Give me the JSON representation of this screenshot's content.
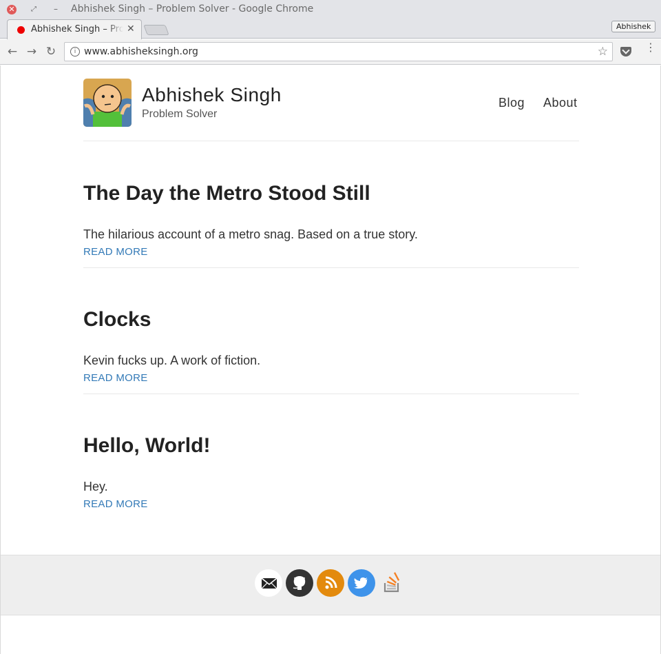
{
  "window": {
    "title": "Abhishek Singh – Problem Solver - Google Chrome",
    "close_glyph": "✕",
    "restore_glyph": "⤢",
    "minimize_glyph": "–",
    "profile_name": "Abhishek"
  },
  "tab": {
    "title": "Abhishek Singh – Problem Solver",
    "close_glyph": "✕",
    "favicon_color": "#ee0000"
  },
  "toolbar": {
    "back_icon": "←",
    "forward_icon": "→",
    "reload_icon": "↻",
    "info_icon": "i",
    "url": "www.abhisheksingh.org",
    "star_icon": "☆",
    "menu_icon": "⋮"
  },
  "site": {
    "title": "Abhishek Singh",
    "subtitle": "Problem Solver",
    "nav": [
      {
        "label": "Blog"
      },
      {
        "label": "About"
      }
    ]
  },
  "posts": [
    {
      "title": "The Day the Metro Stood Still",
      "excerpt": "The hilarious account of a metro snag. Based on a true story.",
      "more": "READ MORE"
    },
    {
      "title": "Clocks",
      "excerpt": "Kevin fucks up. A work of fiction.",
      "more": "READ MORE"
    },
    {
      "title": "Hello, World!",
      "excerpt": "Hey.",
      "more": "READ MORE"
    }
  ],
  "footer": {
    "social": [
      {
        "icon": "mail-icon"
      },
      {
        "icon": "github-icon"
      },
      {
        "icon": "rss-icon"
      },
      {
        "icon": "twitter-icon"
      },
      {
        "icon": "stackoverflow-icon"
      }
    ]
  },
  "colors": {
    "link": "#337ab7",
    "rss": "#e38a0d",
    "twitter": "#3e93ea",
    "github": "#333333",
    "stackoverflow": "#f48024"
  }
}
